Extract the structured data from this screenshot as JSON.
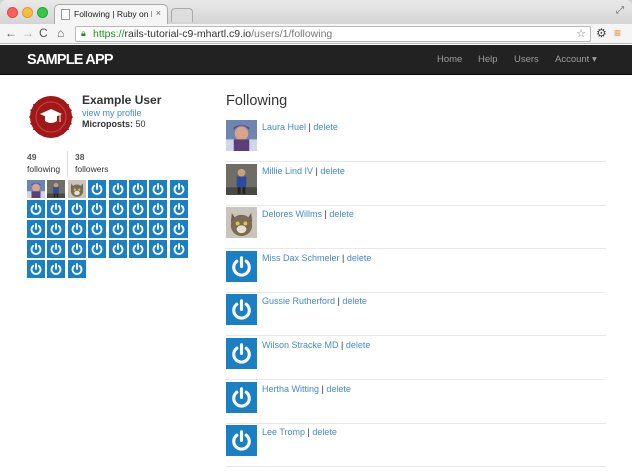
{
  "browser": {
    "tab_title": "Following | Ruby on Rails T",
    "tab_close": "×",
    "url_scheme": "https://",
    "url_host": "rails-tutorial-c9-mhartl.c9.io",
    "url_path": "/users/1/following",
    "icons": [
      "back-icon",
      "forward-icon",
      "reload-icon",
      "home-icon",
      "lock-icon",
      "star-icon",
      "wrench-icon",
      "menu-icon"
    ]
  },
  "navbar": {
    "logo": "SAMPLE APP",
    "links": {
      "home": "Home",
      "help": "Help",
      "users": "Users",
      "account": "Account ▾"
    },
    "background": "#222222"
  },
  "sidebar": {
    "user_name": "Example User",
    "profile_link": "view my profile",
    "microposts_label": "Microposts:",
    "microposts_count": "50",
    "following_count": "49",
    "following_label": "following",
    "followers_count": "38",
    "followers_label": "followers",
    "gravatar_count": 35
  },
  "main": {
    "heading": "Following",
    "sep": "|",
    "delete_label": "delete",
    "users": [
      {
        "name": "Laura Huel",
        "avatar": "photo-snow"
      },
      {
        "name": "Millie Lind IV",
        "avatar": "photo-person"
      },
      {
        "name": "Delores Willms",
        "avatar": "photo-cat"
      },
      {
        "name": "Miss Dax Schmeler",
        "avatar": "power"
      },
      {
        "name": "Gussie Rutherford",
        "avatar": "power"
      },
      {
        "name": "Wilson Stracke MD",
        "avatar": "power"
      },
      {
        "name": "Hertha Witting",
        "avatar": "power"
      },
      {
        "name": "Lee Tromp",
        "avatar": "power"
      }
    ]
  },
  "colors": {
    "link": "#428bca",
    "gravatar_blue": "#1b7fc3",
    "badge_red": "#a01818"
  }
}
